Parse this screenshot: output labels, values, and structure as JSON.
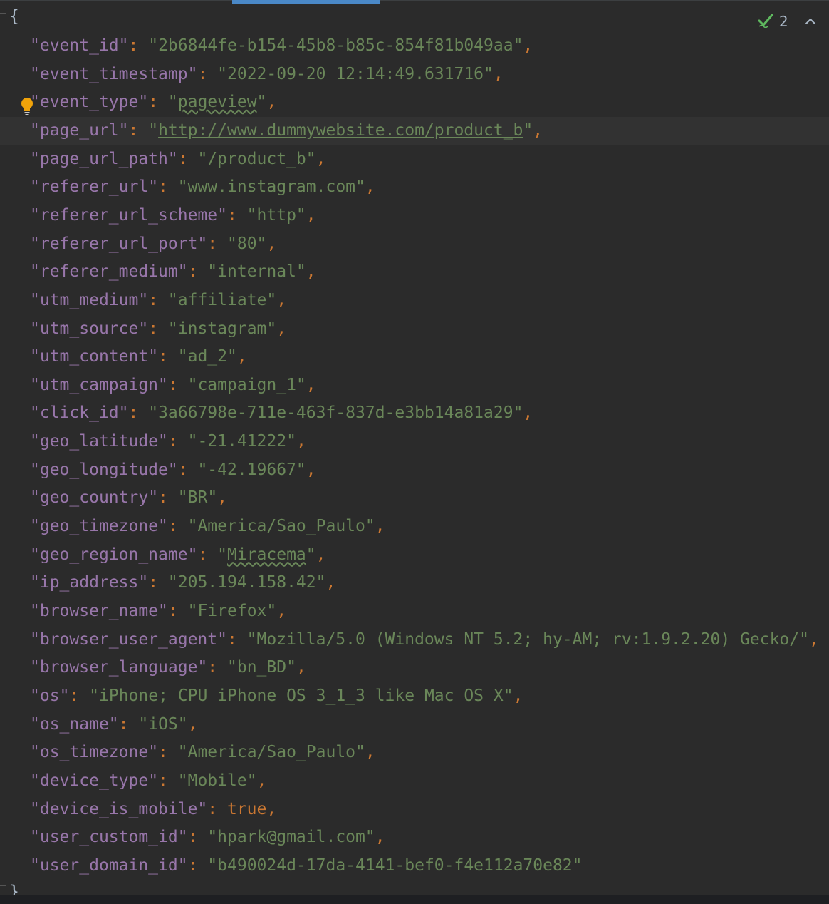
{
  "editor": {
    "open_brace": "{",
    "close_brace": "}",
    "inspection_count": "2",
    "lines": [
      {
        "key": "event_id",
        "value": "2b6844fe-b154-45b8-b85c-854f81b049aa"
      },
      {
        "key": "event_timestamp",
        "value": "2022-09-20 12:14:49.631716"
      },
      {
        "key": "event_type",
        "value": "pageview"
      },
      {
        "key": "page_url",
        "value": "http://www.dummywebsite.com/product_b"
      },
      {
        "key": "page_url_path",
        "value": "/product_b"
      },
      {
        "key": "referer_url",
        "value": "www.instagram.com"
      },
      {
        "key": "referer_url_scheme",
        "value": "http"
      },
      {
        "key": "referer_url_port",
        "value": "80"
      },
      {
        "key": "referer_medium",
        "value": "internal"
      },
      {
        "key": "utm_medium",
        "value": "affiliate"
      },
      {
        "key": "utm_source",
        "value": "instagram"
      },
      {
        "key": "utm_content",
        "value": "ad_2"
      },
      {
        "key": "utm_campaign",
        "value": "campaign_1"
      },
      {
        "key": "click_id",
        "value": "3a66798e-711e-463f-837d-e3bb14a81a29"
      },
      {
        "key": "geo_latitude",
        "value": "-21.41222"
      },
      {
        "key": "geo_longitude",
        "value": "-42.19667"
      },
      {
        "key": "geo_country",
        "value": "BR"
      },
      {
        "key": "geo_timezone",
        "value": "America/Sao_Paulo"
      },
      {
        "key": "geo_region_name",
        "value": "Miracema"
      },
      {
        "key": "ip_address",
        "value": "205.194.158.42"
      },
      {
        "key": "browser_name",
        "value": "Firefox"
      },
      {
        "key": "browser_user_agent",
        "value": "Mozilla/5.0 (Windows NT 5.2; hy-AM; rv:1.9.2.20) Gecko/"
      },
      {
        "key": "browser_language",
        "value": "bn_BD"
      },
      {
        "key": "os",
        "value": "iPhone; CPU iPhone OS 3_1_3 like Mac OS X"
      },
      {
        "key": "os_name",
        "value": "iOS"
      },
      {
        "key": "os_timezone",
        "value": "America/Sao_Paulo"
      },
      {
        "key": "device_type",
        "value": "Mobile"
      },
      {
        "key": "device_is_mobile",
        "value": "true",
        "bool": true
      },
      {
        "key": "user_custom_id",
        "value": "hpark@gmail.com"
      },
      {
        "key": "user_domain_id",
        "value": "b490024d-17da-4141-bef0-f4e112a70e82",
        "last": true
      }
    ]
  },
  "colors": {
    "background": "#2b2b2b",
    "key": "#9876aa",
    "string": "#6a8759",
    "punctuation": "#cc7832",
    "current_line": "#323232",
    "tab_accent": "#4a88c7"
  },
  "icons": {
    "inspection_ok": "check-icon",
    "navigate_up": "chevron-up-icon",
    "intention": "lightbulb-icon"
  }
}
